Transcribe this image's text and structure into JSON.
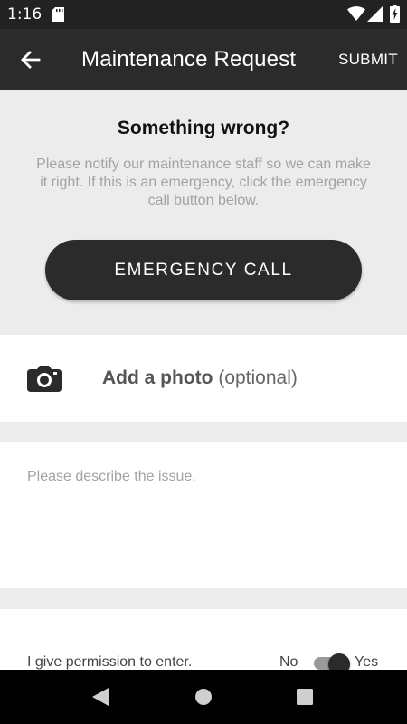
{
  "status_bar": {
    "time": "1:16",
    "icons": [
      "sd-card-icon",
      "wifi-icon",
      "signal-icon",
      "battery-charging-icon"
    ]
  },
  "app_bar": {
    "title": "Maintenance Request",
    "submit_label": "SUBMIT",
    "back_icon": "arrow-left-icon"
  },
  "intro": {
    "heading": "Something wrong?",
    "description": "Please notify our maintenance staff so we can make it right. If this is an emergency, click the emergency call button below.",
    "emergency_label": "EMERGENCY CALL"
  },
  "photo": {
    "label": "Add a photo",
    "optional": "(optional)",
    "icon": "camera-icon"
  },
  "description_field": {
    "value": "",
    "placeholder": "Please describe the issue."
  },
  "permission": {
    "label": "I give permission to enter.",
    "no_label": "No",
    "yes_label": "Yes",
    "selected": "Yes"
  },
  "nav_bar": {
    "icons": [
      "nav-back-icon",
      "nav-home-icon",
      "nav-recents-icon"
    ]
  },
  "colors": {
    "app_bar": "#2b2b2b",
    "status_bar": "#222222",
    "background": "#ececec",
    "card": "#ffffff",
    "muted_text": "#a3a3a3"
  }
}
